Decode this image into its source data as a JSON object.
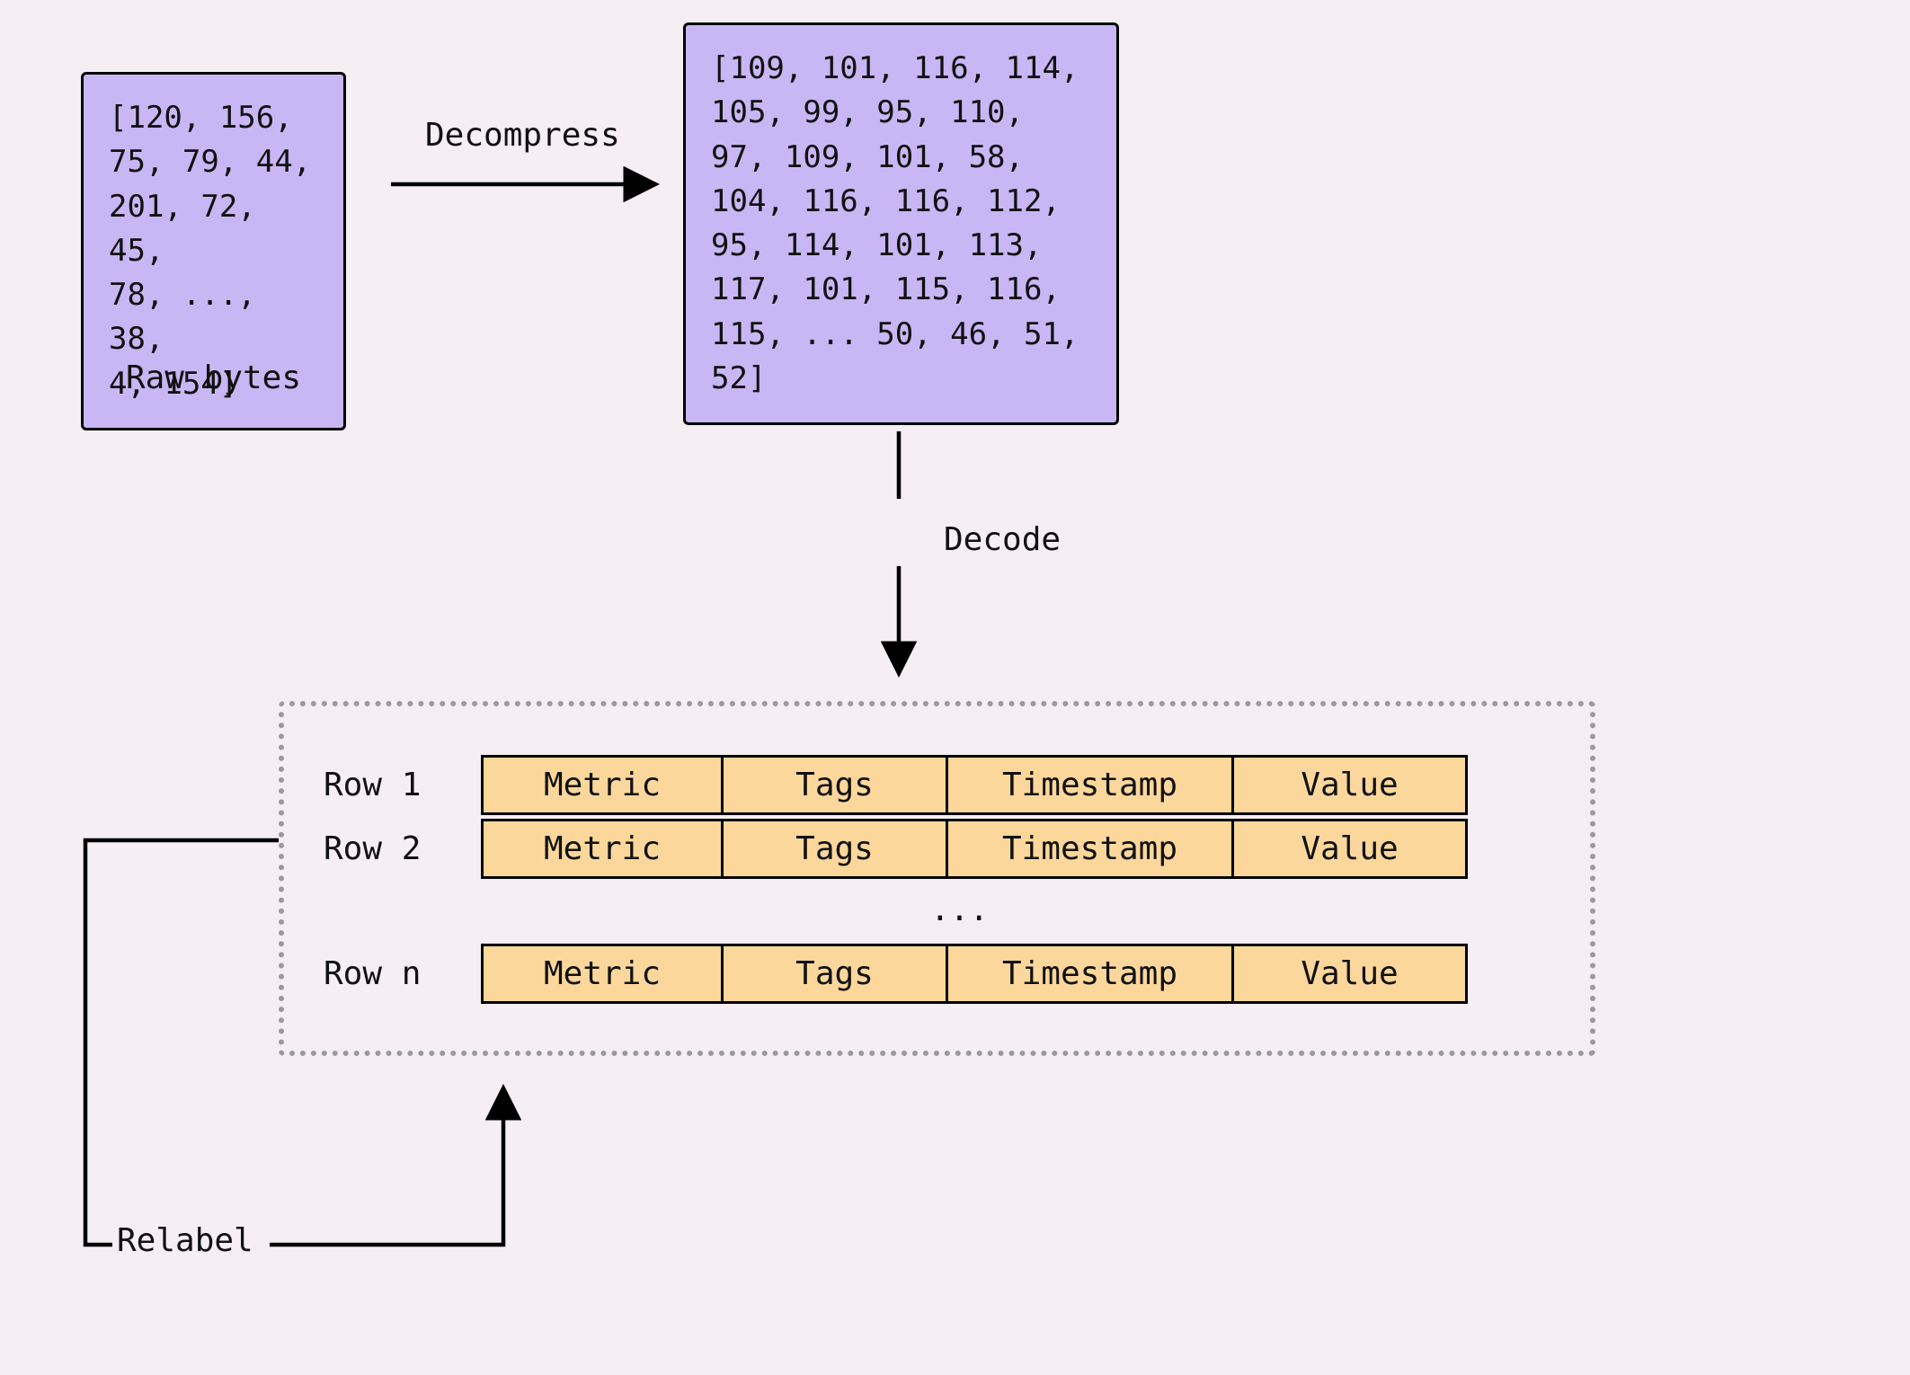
{
  "raw_bytes_box": "[120, 156,\n75, 79, 44,\n201, 72, 45,\n78, ..., 38,\n4, 154]",
  "raw_bytes_caption": "Raw bytes",
  "decompress_label": "Decompress",
  "decompressed_box": "[109, 101, 116, 114,\n105, 99, 95, 110,\n97, 109, 101, 58,\n104, 116, 116, 112,\n95, 114, 101, 113,\n117, 101, 115, 116,\n115, ... 50, 46, 51,\n52]",
  "decode_label": "Decode",
  "rows": {
    "labels": [
      "Row 1",
      "Row 2",
      "Row n"
    ],
    "ellipsis": "...",
    "columns": [
      "Metric",
      "Tags",
      "Timestamp",
      "Value"
    ]
  },
  "relabel_label": "Relabel"
}
